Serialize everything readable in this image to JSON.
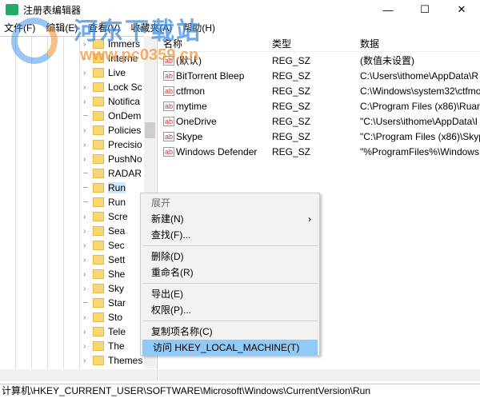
{
  "window": {
    "title": "注册表编辑器",
    "min": "—",
    "max": "☐",
    "close": "✕"
  },
  "menu": [
    "文件(F)",
    "编辑(E)",
    "查看(V)",
    "收藏夹(A)",
    "帮助(H)"
  ],
  "tree": [
    {
      "label": "Immers",
      "exp": true
    },
    {
      "label": "Interne",
      "exp": true
    },
    {
      "label": "Live",
      "exp": true
    },
    {
      "label": "Lock Sc",
      "exp": true
    },
    {
      "label": "Notifica",
      "exp": true
    },
    {
      "label": "OnDem",
      "exp": false
    },
    {
      "label": "Policies",
      "exp": true
    },
    {
      "label": "Precisio",
      "exp": true
    },
    {
      "label": "PushNo",
      "exp": true
    },
    {
      "label": "RADAR",
      "exp": false
    },
    {
      "label": "Run",
      "exp": false,
      "sel": true
    },
    {
      "label": "Run",
      "exp": false
    },
    {
      "label": "Scre",
      "exp": true
    },
    {
      "label": "Sea",
      "exp": true
    },
    {
      "label": "Sec",
      "exp": true
    },
    {
      "label": "Sett",
      "exp": true
    },
    {
      "label": "She",
      "exp": true
    },
    {
      "label": "Sky",
      "exp": true
    },
    {
      "label": "Star",
      "exp": false
    },
    {
      "label": "Sto",
      "exp": true
    },
    {
      "label": "Tele",
      "exp": true
    },
    {
      "label": "The",
      "exp": true
    },
    {
      "label": "Themes",
      "exp": true
    }
  ],
  "columns": {
    "name": "名称",
    "type": "类型",
    "data": "数据"
  },
  "values": [
    {
      "name": "(默认)",
      "type": "REG_SZ",
      "data": "(数值未设置)"
    },
    {
      "name": "BitTorrent Bleep",
      "type": "REG_SZ",
      "data": "C:\\Users\\ithome\\AppData\\R"
    },
    {
      "name": "ctfmon",
      "type": "REG_SZ",
      "data": "C:\\Windows\\system32\\ctfmo"
    },
    {
      "name": "mytime",
      "type": "REG_SZ",
      "data": "C:\\Program Files (x86)\\Ruan"
    },
    {
      "name": "OneDrive",
      "type": "REG_SZ",
      "data": "\"C:\\Users\\ithome\\AppData\\I"
    },
    {
      "name": "Skype",
      "type": "REG_SZ",
      "data": "\"C:\\Program Files (x86)\\Skyp"
    },
    {
      "name": "Windows Defender",
      "type": "REG_SZ",
      "data": "\"%ProgramFiles%\\Windows"
    }
  ],
  "context_menu": {
    "expand": "展开",
    "new": "新建(N)",
    "find": "查找(F)...",
    "delete": "删除(D)",
    "rename": "重命名(R)",
    "export": "导出(E)",
    "permissions": "权限(P)...",
    "copy_key": "复制项名称(C)",
    "goto": "访问 HKEY_LOCAL_MACHINE(T)"
  },
  "status": "计算机\\HKEY_CURRENT_USER\\SOFTWARE\\Microsoft\\Windows\\CurrentVersion\\Run",
  "watermark": {
    "name": "河东下载站",
    "url": "www.pc0359.cn"
  }
}
